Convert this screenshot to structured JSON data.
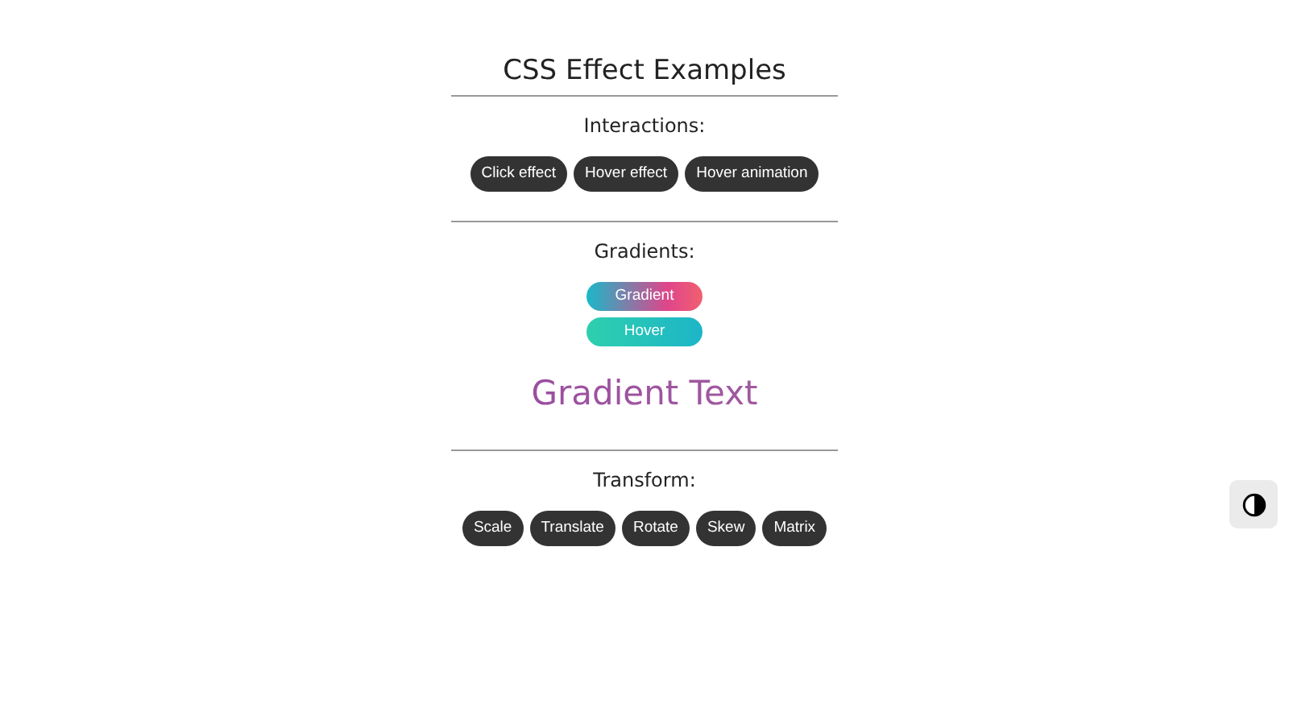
{
  "title": "CSS Effect Examples",
  "sections": [
    {
      "heading": "Interactions:",
      "items": [
        {
          "kind": "dark",
          "label": "Click effect"
        },
        {
          "kind": "dark",
          "label": "Hover effect"
        },
        {
          "kind": "dark",
          "label": "Hover animation"
        }
      ]
    },
    {
      "heading": "Gradients:",
      "items": [
        {
          "kind": "gradient-pink",
          "label": "Gradient"
        },
        {
          "kind": "gradient-teal",
          "label": "Hover"
        },
        {
          "kind": "gradient-text",
          "label": "Gradient Text"
        }
      ]
    },
    {
      "heading": "Transform:",
      "items": [
        {
          "kind": "dark",
          "label": "Scale"
        },
        {
          "kind": "dark",
          "label": "Translate"
        },
        {
          "kind": "dark",
          "label": "Rotate"
        },
        {
          "kind": "dark",
          "label": "Skew"
        },
        {
          "kind": "dark",
          "label": "Matrix"
        }
      ]
    }
  ],
  "theme_toggle": {
    "kind": "contrast"
  }
}
